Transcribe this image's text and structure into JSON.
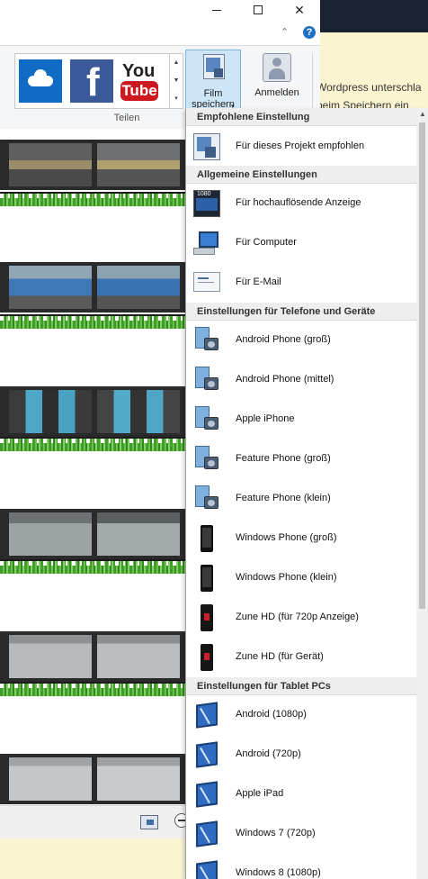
{
  "window": {
    "min_glyph": "",
    "max_glyph": "",
    "close_glyph": "✕",
    "help_glyph": "?",
    "collapse_glyph": "⌃"
  },
  "background_page": {
    "line1": "Wordpress unterschla",
    "line2": "beim Speichern ein"
  },
  "ribbon": {
    "gallery": [
      {
        "name": "onedrive",
        "icon": "onedrive-icon"
      },
      {
        "name": "facebook",
        "icon": "facebook-icon",
        "text": "f"
      },
      {
        "name": "youtube",
        "icon": "youtube-icon",
        "text_top": "You",
        "text_bottom": "Tube"
      }
    ],
    "film_speichern": {
      "line1": "Film",
      "line2": "speichern",
      "caret": "▾"
    },
    "anmelden": "Anmelden",
    "group_label": "Teilen"
  },
  "menu": {
    "sections": [
      {
        "header": "Empfohlene Einstellung",
        "items": [
          {
            "label": "Für dieses Projekt empfohlen",
            "icon": "project-settings-icon"
          }
        ]
      },
      {
        "header": "Allgemeine Einstellungen",
        "items": [
          {
            "label": "Für hochauflösende Anzeige",
            "icon": "hd-display-icon"
          },
          {
            "label": "Für Computer",
            "icon": "computer-icon"
          },
          {
            "label": "Für E-Mail",
            "icon": "email-icon"
          }
        ]
      },
      {
        "header": "Einstellungen für Telefone und Geräte",
        "items": [
          {
            "label": "Android Phone (groß)",
            "icon": "phone-camera-icon"
          },
          {
            "label": "Android Phone (mittel)",
            "icon": "phone-camera-icon"
          },
          {
            "label": "Apple iPhone",
            "icon": "phone-camera-icon"
          },
          {
            "label": "Feature Phone (groß)",
            "icon": "phone-camera-icon"
          },
          {
            "label": "Feature Phone (klein)",
            "icon": "phone-camera-icon"
          },
          {
            "label": "Windows Phone (groß)",
            "icon": "windows-phone-icon"
          },
          {
            "label": "Windows Phone (klein)",
            "icon": "windows-phone-icon"
          },
          {
            "label": "Zune HD (für 720p Anzeige)",
            "icon": "zune-icon"
          },
          {
            "label": "Zune HD (für Gerät)",
            "icon": "zune-icon"
          }
        ]
      },
      {
        "header": "Einstellungen für Tablet PCs",
        "items": [
          {
            "label": "Android (1080p)",
            "icon": "tablet-icon"
          },
          {
            "label": "Android (720p)",
            "icon": "tablet-icon"
          },
          {
            "label": "Apple iPad",
            "icon": "tablet-icon"
          },
          {
            "label": "Windows 7 (720p)",
            "icon": "tablet-icon"
          },
          {
            "label": "Windows 8 (1080p)",
            "icon": "tablet-icon"
          }
        ]
      }
    ]
  },
  "timeline": {
    "clips": [
      {
        "name": "clip-1",
        "colors": [
          "#6a6a6a",
          "#8d8f91"
        ]
      },
      {
        "name": "clip-2",
        "colors": [
          "#8fa8bb",
          "#7d97ad"
        ]
      },
      {
        "name": "clip-3",
        "colors": [
          "#4a4a4a",
          "#606365"
        ]
      },
      {
        "name": "clip-4",
        "colors": [
          "#9aa0a4",
          "#a9afb2"
        ]
      },
      {
        "name": "clip-5",
        "colors": [
          "#a8acae",
          "#b3b7b9"
        ]
      },
      {
        "name": "clip-6",
        "colors": [
          "#b8bcbe",
          "#c2c5c7"
        ]
      }
    ]
  },
  "colors": {
    "accent": "#7eb4ea",
    "selected_button_bg": "#cde6f7",
    "audio_green": "#3d9e2c",
    "yellow_pane": "#fbf4d1",
    "dark_bar": "#1a2131"
  }
}
